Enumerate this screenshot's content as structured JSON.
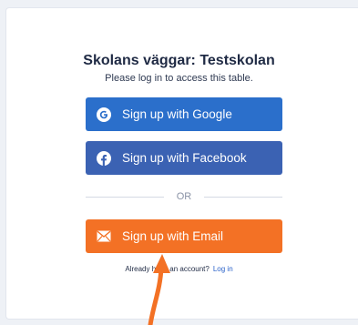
{
  "heading": {
    "title": "Skolans väggar: Testskolan",
    "subtitle": "Please log in to access this table."
  },
  "buttons": {
    "google": {
      "label": "Sign up with Google",
      "icon": "google-icon"
    },
    "facebook": {
      "label": "Sign up with Facebook",
      "icon": "facebook-icon"
    },
    "email": {
      "label": "Sign up with Email",
      "icon": "envelope-icon"
    }
  },
  "divider": {
    "text": "OR"
  },
  "footer": {
    "text": "Already have an account?",
    "login_link": "Log in"
  },
  "colors": {
    "google": "#2b6fcb",
    "facebook": "#3b62b3",
    "email": "#f37125",
    "link": "#2a62c9",
    "annotation": "#f37125"
  }
}
